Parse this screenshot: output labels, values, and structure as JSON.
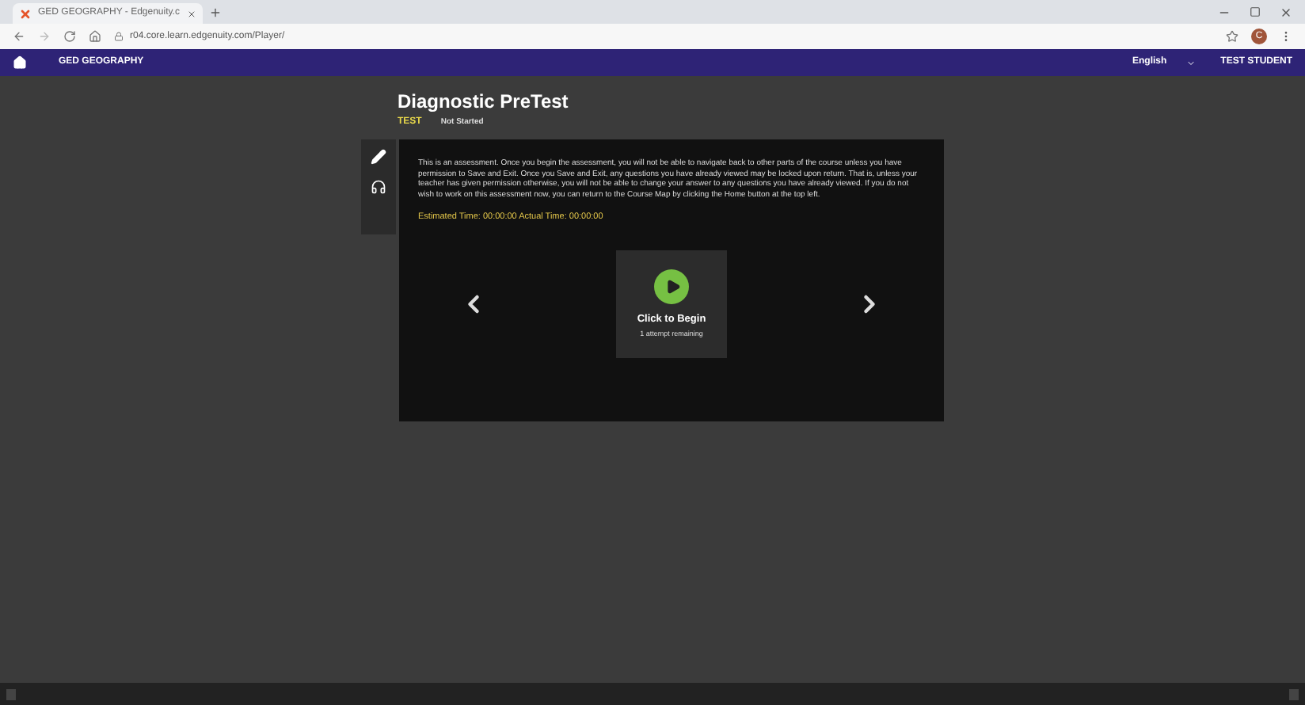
{
  "browser": {
    "tab_title": "GED GEOGRAPHY - Edgenuity.c",
    "url": "r04.core.learn.edgenuity.com/Player/",
    "avatar_letter": "C"
  },
  "nav": {
    "course": "GED GEOGRAPHY",
    "language": "English",
    "user": "TEST STUDENT"
  },
  "activity": {
    "title": "Diagnostic PreTest",
    "type": "TEST",
    "status": "Not Started"
  },
  "panel": {
    "intro": "This is an assessment. Once you begin the assessment, you will not be able to navigate back to other parts of the course unless you have permission to Save and Exit. Once you Save and Exit, any questions you have already viewed may be locked upon return. That is, unless your teacher has given permission otherwise, you will not be able to change your answer to any questions you have already viewed. If you do not wish to work on this assessment now, you can return to the Course Map by clicking the Home button at the top left.",
    "times": "Estimated Time: 00:00:00 Actual Time: 00:00:00",
    "begin_label": "Click to Begin",
    "attempts": "1 attempt remaining"
  }
}
